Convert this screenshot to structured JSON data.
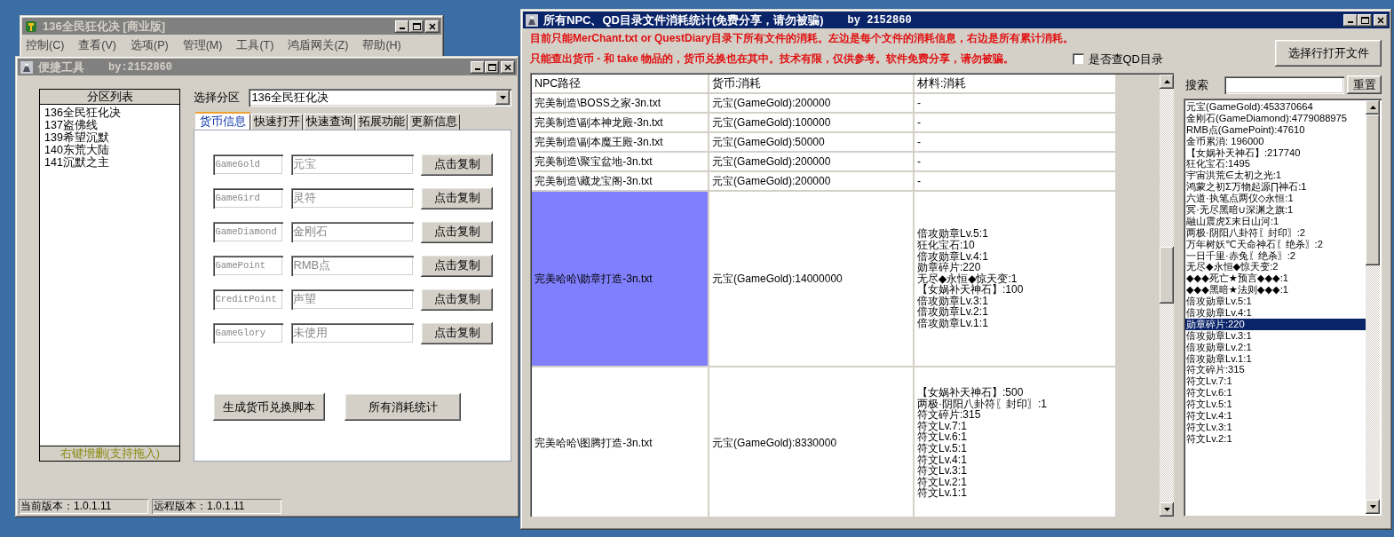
{
  "back_window": {
    "title": "136全民狂化决 [商业版]",
    "active": false,
    "menu": [
      "控制(C)",
      "查看(V)",
      "选项(P)",
      "管理(M)",
      "工具(T)",
      "鸿盾网关(Z)",
      "帮助(H)"
    ]
  },
  "tool_window": {
    "title": "便捷工具",
    "subtitle": "by:2152860",
    "active": false,
    "partition_list": {
      "header": "分区列表",
      "footer": "右键增删(支持拖入)",
      "items": [
        {
          "label": "136全民狂化决",
          "selected": false
        },
        {
          "label": "137盗佛线",
          "selected": false
        },
        {
          "label": "139希望沉默",
          "selected": false
        },
        {
          "label": "140东荒大陆",
          "selected": false
        },
        {
          "label": "141沉默之主",
          "selected": false
        }
      ]
    },
    "partition_select": {
      "label": "选择分区",
      "value": "136全民狂化决"
    },
    "tabs": [
      {
        "label": "货币信息",
        "selected": true
      },
      {
        "label": "快速打开",
        "selected": false
      },
      {
        "label": "快速查询",
        "selected": false
      },
      {
        "label": "拓展功能",
        "selected": false
      },
      {
        "label": "更新信息",
        "selected": false
      }
    ],
    "currency_rows": [
      {
        "code": "GameGold",
        "name": "元宝",
        "button": "点击复制"
      },
      {
        "code": "GameGird",
        "name": "灵符",
        "button": "点击复制"
      },
      {
        "code": "GameDiamond",
        "name": "金刚石",
        "button": "点击复制"
      },
      {
        "code": "GamePoint",
        "name": "RMB点",
        "button": "点击复制"
      },
      {
        "code": "CreditPoint",
        "name": "声望",
        "button": "点击复制"
      },
      {
        "code": "GameGlory",
        "name": "未使用",
        "button": "点击复制"
      }
    ],
    "actions": [
      "生成货币兑换脚本",
      "所有消耗统计"
    ],
    "status_bar": [
      "当前版本：1.0.1.11",
      "远程版本：1.0.1.11"
    ]
  },
  "stats_window": {
    "title": "所有NPC、QD目录文件消耗统计(免费分享，请勿被骗)",
    "subtitle": "by 2152860",
    "active": true,
    "notes": [
      "目前只能MerChant.txt or QuestDiary目录下所有文件的消耗。左边是每个文件的消耗信息，右边是所有累计消耗。",
      "只能查出货币 - 和 take 物品的，货币兑换也在其中。技术有限，仅供参考。软件免费分享，请勿被骗。"
    ],
    "qd_checkbox": {
      "label": "是否查QD目录",
      "checked": false
    },
    "open_button": "选择行打开文件",
    "search": {
      "label": "搜索",
      "reset_button": "重置"
    },
    "table": {
      "columns": [
        "NPC路径",
        "货币:消耗",
        "材料:消耗"
      ],
      "rows": [
        {
          "path": "完美制造\\BOSS之家-3n.txt",
          "currency": "元宝(GameGold):200000",
          "materials": [
            "-"
          ],
          "selected": false
        },
        {
          "path": "完美制造\\副本神龙殿-3n.txt",
          "currency": "元宝(GameGold):100000",
          "materials": [
            "-"
          ],
          "selected": false
        },
        {
          "path": "完美制造\\副本魔王殿-3n.txt",
          "currency": "元宝(GameGold):50000",
          "materials": [
            "-"
          ],
          "selected": false
        },
        {
          "path": "完美制造\\聚宝盆地-3n.txt",
          "currency": "元宝(GameGold):200000",
          "materials": [
            "-"
          ],
          "selected": false
        },
        {
          "path": "完美制造\\藏龙宝阁-3n.txt",
          "currency": "元宝(GameGold):200000",
          "materials": [
            "-"
          ],
          "selected": false
        },
        {
          "path": "完美哈哈\\勋章打造-3n.txt",
          "currency": "元宝(GameGold):14000000",
          "materials": [
            "倍攻勋章Lv.5:1",
            "狂化宝石:10",
            "倍攻勋章Lv.4:1",
            "勋章碎片:220",
            "无尽◆永恒◆惊天变:1",
            "【女娲补天神石】:100",
            "倍攻勋章Lv.3:1",
            "倍攻勋章Lv.2:1",
            "倍攻勋章Lv.1:1"
          ],
          "selected": true
        },
        {
          "path": "完美哈哈\\图腾打造-3n.txt",
          "currency": "元宝(GameGold):8330000",
          "materials": [
            "【女娲补天神石】:500",
            "两极·阴阳八卦符〖封印〗:1",
            "符文碎片:315",
            "符文Lv.7:1",
            "符文Lv.6:1",
            "符文Lv.5:1",
            "符文Lv.4:1",
            "符文Lv.3:1",
            "符文Lv.2:1",
            "符文Lv.1:1"
          ],
          "selected": false
        }
      ]
    },
    "totals": [
      {
        "label": "元宝(GameGold):453370664",
        "selected": false
      },
      {
        "label": "金刚石(GameDiamond):4779088975",
        "selected": false
      },
      {
        "label": "RMB点(GamePoint):47610",
        "selected": false
      },
      {
        "label": "金币累消: 196000",
        "selected": false
      },
      {
        "label": "【女娲补天神石】:217740",
        "selected": false
      },
      {
        "label": "狂化宝石:1495",
        "selected": false
      },
      {
        "label": "宇宙洪荒∈太初之光:1",
        "selected": false
      },
      {
        "label": "鸿蒙之初Σ万物起源∏神石:1",
        "selected": false
      },
      {
        "label": "六道·执笔点两仪◇永恒:1",
        "selected": false
      },
      {
        "label": "冥·无尽黑暗∪深渊之旗:1",
        "selected": false
      },
      {
        "label": "融山震虎Σ末日山河:1",
        "selected": false
      },
      {
        "label": "两极·阴阳八卦符〖封印〗:2",
        "selected": false
      },
      {
        "label": "万年树妖℃天命神石〖绝杀〗:2",
        "selected": false
      },
      {
        "label": "一日千里·赤兔〖绝杀〗:2",
        "selected": false
      },
      {
        "label": "无尽◆永恒◆惊天变:2",
        "selected": false
      },
      {
        "label": "◆◆◆死亡★预言◆◆◆:1",
        "selected": false
      },
      {
        "label": "◆◆◆黑暗★法则◆◆◆:1",
        "selected": false
      },
      {
        "label": "倍攻勋章Lv.5:1",
        "selected": false
      },
      {
        "label": "倍攻勋章Lv.4:1",
        "selected": false
      },
      {
        "label": "勋章碎片:220",
        "selected": true
      },
      {
        "label": "倍攻勋章Lv.3:1",
        "selected": false
      },
      {
        "label": "倍攻勋章Lv.2:1",
        "selected": false
      },
      {
        "label": "倍攻勋章Lv.1:1",
        "selected": false
      },
      {
        "label": "符文碎片:315",
        "selected": false
      },
      {
        "label": "符文Lv.7:1",
        "selected": false
      },
      {
        "label": "符文Lv.6:1",
        "selected": false
      },
      {
        "label": "符文Lv.5:1",
        "selected": false
      },
      {
        "label": "符文Lv.4:1",
        "selected": false
      },
      {
        "label": "符文Lv.3:1",
        "selected": false
      },
      {
        "label": "符文Lv.2:1",
        "selected": false
      }
    ]
  }
}
